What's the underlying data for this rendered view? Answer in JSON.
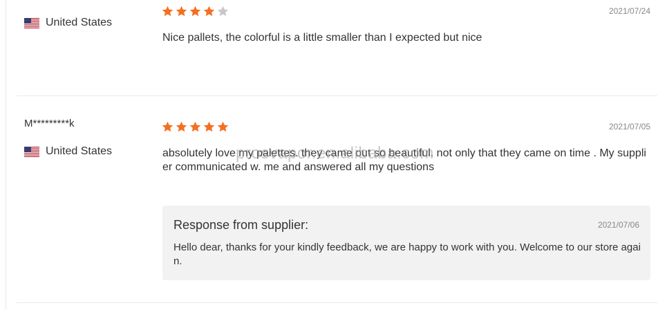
{
  "colors": {
    "star_filled": "#f36f21",
    "star_empty": "#c8c8c8",
    "divider": "#e8e8e8",
    "response_bg": "#f2f2f2"
  },
  "reviews": [
    {
      "user": "",
      "country": "United States",
      "flag_icon": "us-flag-icon",
      "rating": 4,
      "rating_max": 5,
      "date": "2021/07/24",
      "text": "Nice pallets, the colorful is a little smaller than I expected but nice"
    },
    {
      "user": "M*********k",
      "country": "United States",
      "flag_icon": "us-flag-icon",
      "rating": 5,
      "rating_max": 5,
      "date": "2021/07/05",
      "text": "absolutely love my palettes. they came out so beautiful. not only that they came on time . My supplier communicated w. me and answered all my questions",
      "response": {
        "title": "Response from supplier:",
        "date": "2021/07/06",
        "text": "Hello dear, thanks for your kindly feedback, we are happy to work with you. Welcome to our store again."
      }
    }
  ],
  "watermark": "prosvapor.en.alibaba.com"
}
